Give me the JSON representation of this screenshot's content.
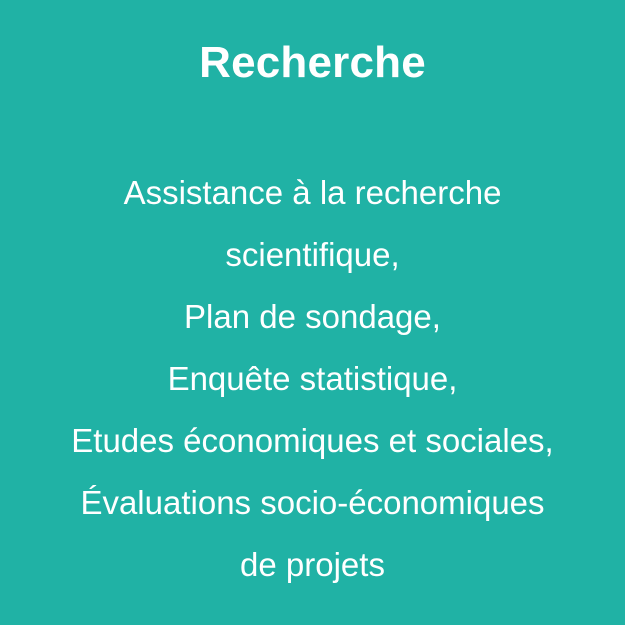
{
  "title": "Recherche",
  "lines": [
    "Assistance à la recherche",
    "scientifique,",
    "Plan de sondage,",
    "Enquête statistique,",
    "Etudes économiques et sociales,",
    "Évaluations socio-économiques",
    "de projets"
  ],
  "colors": {
    "background": "#20b2a5",
    "text": "#ffffff"
  }
}
